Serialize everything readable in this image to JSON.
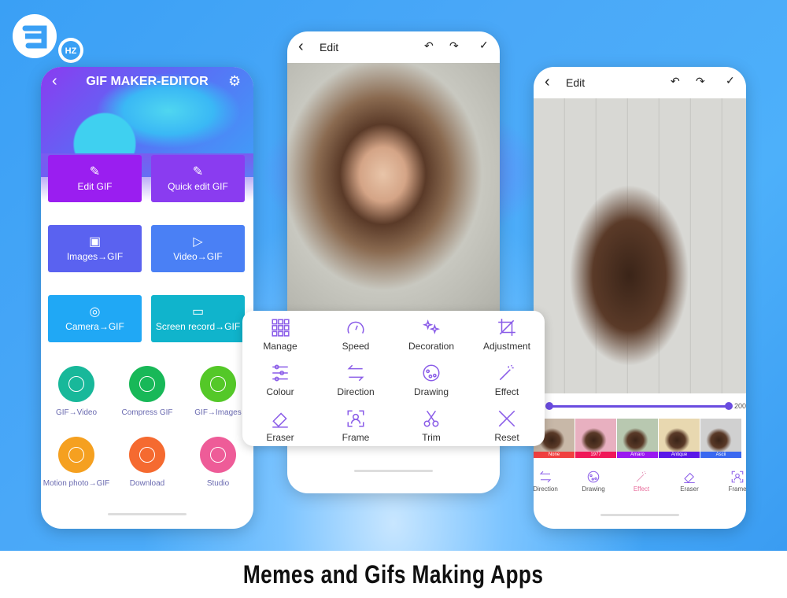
{
  "logo": {
    "text": "9",
    "badge": "HZ"
  },
  "footer": {
    "title": "Memes and Gifs Making Apps"
  },
  "phone1": {
    "title": "GIF MAKER-EDITOR",
    "back_icon": "chevron-left",
    "settings_icon": "gear",
    "buttons": [
      {
        "label": "Edit GIF",
        "color": "#9a1ef0",
        "icon": "brush"
      },
      {
        "label": "Quick edit GIF",
        "color": "#8a3cf0",
        "icon": "brush"
      },
      {
        "label": "Images→GIF",
        "color": "#5a62f0",
        "icon": "image"
      },
      {
        "label": "Video→GIF",
        "color": "#4a80f5",
        "icon": "play"
      },
      {
        "label": "Camera→GIF",
        "color": "#20a8f5",
        "icon": "camera"
      },
      {
        "label": "Screen record→GIF",
        "color": "#10b4cc",
        "icon": "rec"
      }
    ],
    "circles": [
      {
        "label": "GIF→Video",
        "color": "#18b89a"
      },
      {
        "label": "Compress GIF",
        "color": "#18b858"
      },
      {
        "label": "GIF→Images",
        "color": "#54c828"
      },
      {
        "label": "Motion photo→GIF",
        "color": "#f5a020"
      },
      {
        "label": "Download",
        "color": "#f56a30"
      },
      {
        "label": "Studio",
        "color": "#ee5c98"
      }
    ]
  },
  "phone2": {
    "title": "Edit",
    "tools": [
      "Manage",
      "Speed",
      "Decoration",
      "Adjustment",
      "Colour",
      "Direction",
      "Drawing",
      "Effect",
      "Eraser",
      "Frame",
      "Trim",
      "Reset"
    ]
  },
  "phone3": {
    "title": "Edit",
    "slider_value": "200",
    "filters": [
      {
        "label": "None",
        "color": "#f04040"
      },
      {
        "label": "1977",
        "color": "#f01858"
      },
      {
        "label": "Amaro",
        "color": "#9a18f0"
      },
      {
        "label": "Antique",
        "color": "#5a18e8"
      },
      {
        "label": "Ascii",
        "color": "#3a68f0"
      }
    ],
    "tools": [
      "Direction",
      "Drawing",
      "Effect",
      "Eraser",
      "Frame"
    ],
    "active_tool": "Effect"
  },
  "colors": {
    "accent": "#6a4ce0",
    "tool_icon": "#8a5ce8"
  }
}
